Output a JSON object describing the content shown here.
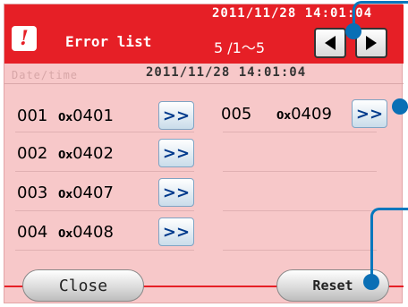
{
  "header": {
    "icon": "exclamation-icon",
    "icon_glyph": "!",
    "title": "Error list",
    "datetime": "2011/11/28 14:01:04",
    "page_indicator": "5 /1～5",
    "prev_icon": "triangle-left-icon",
    "next_icon": "triangle-right-icon"
  },
  "datetime_row": {
    "label": "Date/time",
    "value": "2011/11/28 14:01:04"
  },
  "entries": [
    {
      "num": "001",
      "prefix": "0x",
      "code": "0401",
      "button": ">>"
    },
    {
      "num": "002",
      "prefix": "0x",
      "code": "0402",
      "button": ">>"
    },
    {
      "num": "003",
      "prefix": "0x",
      "code": "0407",
      "button": ">>"
    },
    {
      "num": "004",
      "prefix": "0x",
      "code": "0408",
      "button": ">>"
    },
    {
      "num": "005",
      "prefix": "0x",
      "code": "0409",
      "button": ">>"
    }
  ],
  "footer": {
    "close_label": "Close",
    "reset_label": "Reset"
  },
  "colors": {
    "header_red": "#e61f26",
    "panel_pink": "#f7c8c9",
    "callout_blue": "#0077bd"
  }
}
